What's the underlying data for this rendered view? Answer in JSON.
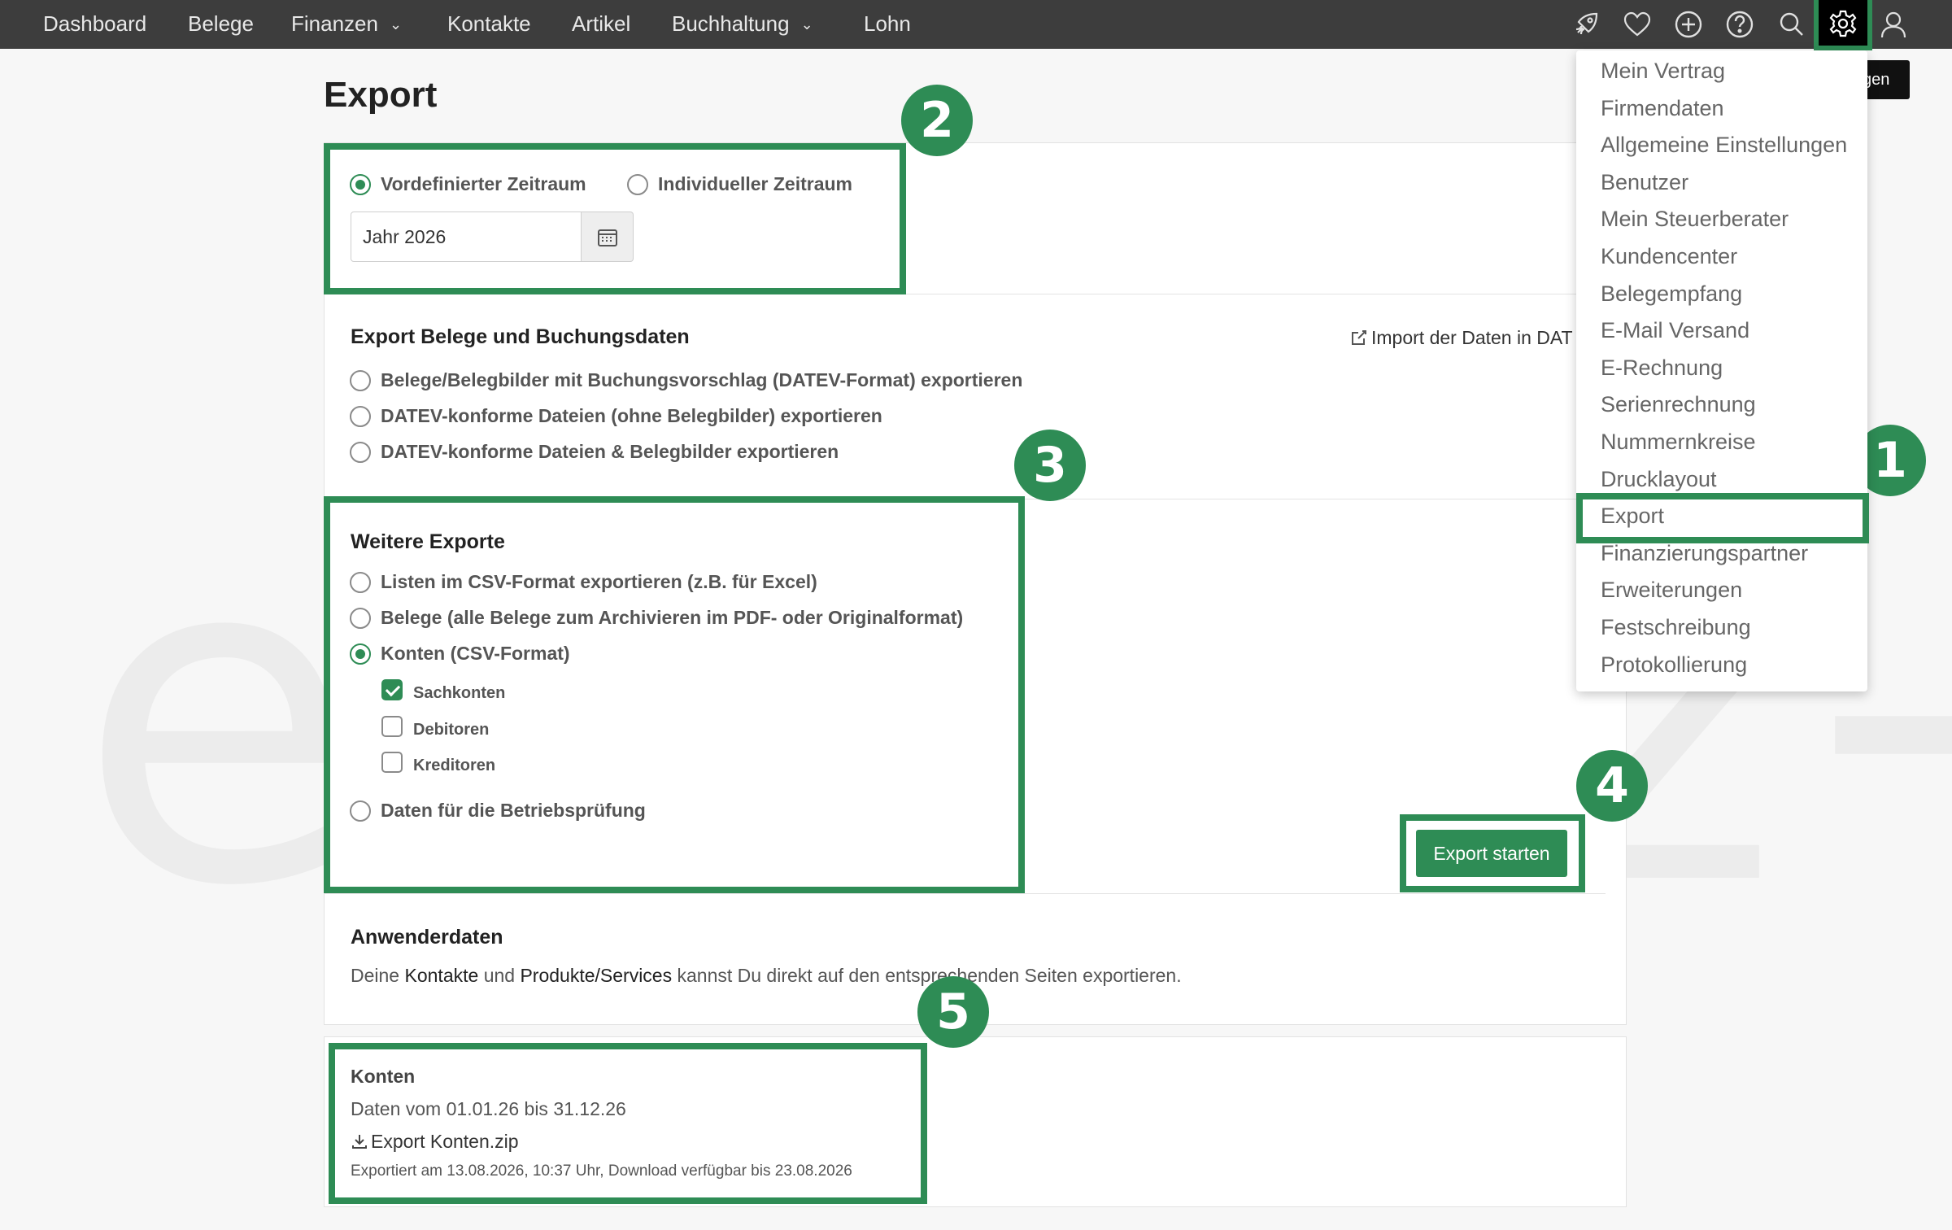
{
  "nav": {
    "dashboard": "Dashboard",
    "belege": "Belege",
    "finanzen": "Finanzen",
    "kontakte": "Kontakte",
    "artikel": "Artikel",
    "buchhaltung": "Buchhaltung",
    "lohn": "Lohn"
  },
  "toolbar_icons": [
    "rocket-icon",
    "heart-icon",
    "plus-circle-icon",
    "help-icon",
    "search-icon",
    "gear-icon",
    "user-icon"
  ],
  "tooltip": "gen",
  "page": {
    "title": "Export"
  },
  "zeitraum": {
    "option_predefined": "Vordefinierter Zeitraum",
    "option_custom": "Individueller Zeitraum",
    "selected": "Vordefinierter Zeitraum",
    "value": "Jahr 2026"
  },
  "belege_section": {
    "heading": "Export Belege und Buchungsdaten",
    "import_link": "Import der Daten in DAT",
    "options": [
      "Belege/Belegbilder mit Buchungsvorschlag (DATEV-Format) exportieren",
      "DATEV-konforme Dateien (ohne Belegbilder) exportieren",
      "DATEV-konforme Dateien & Belegbilder exportieren"
    ]
  },
  "weitere": {
    "heading": "Weitere Exporte",
    "options": [
      "Listen im CSV-Format exportieren (z.B. für Excel)",
      "Belege (alle Belege zum Archivieren im PDF- oder Originalformat)",
      "Konten (CSV-Format)",
      "Daten für die Betriebsprüfung"
    ],
    "selected": "Konten (CSV-Format)",
    "sub_options": [
      {
        "label": "Sachkonten",
        "checked": true
      },
      {
        "label": "Debitoren",
        "checked": false
      },
      {
        "label": "Kreditoren",
        "checked": false
      }
    ]
  },
  "export_button": "Export starten",
  "anwender": {
    "heading": "Anwenderdaten",
    "text_1": "Deine",
    "link_kontakte": "Kontakte",
    "text_2": "und",
    "link_produkte": "Produkte/Services",
    "text_3": "kannst Du direkt auf den entsprechenden Seiten exportieren."
  },
  "result": {
    "title": "Konten",
    "range": "Daten vom 01.01.26 bis 31.12.26",
    "file": "Export Konten.zip",
    "meta": "Exportiert am 13.08.2026, 10:37 Uhr, Download verfügbar bis 23.08.2026"
  },
  "settings_menu": [
    "Mein Vertrag",
    "Firmendaten",
    "Allgemeine Einstellungen",
    "Benutzer",
    "Mein Steuerberater",
    "Kundencenter",
    "Belegempfang",
    "E-Mail Versand",
    "E-Rechnung",
    "Serienrechnung",
    "Nummernkreise",
    "Drucklayout",
    "Export",
    "Finanzierungspartner",
    "Erweiterungen",
    "Festschreibung",
    "Protokollierung"
  ],
  "settings_menu_active": "Export",
  "watermark": "eBilanz+",
  "badges": [
    "1",
    "2",
    "3",
    "4",
    "5"
  ],
  "colors": {
    "accent": "#2e8c55",
    "topbar": "#3d3d3d"
  }
}
